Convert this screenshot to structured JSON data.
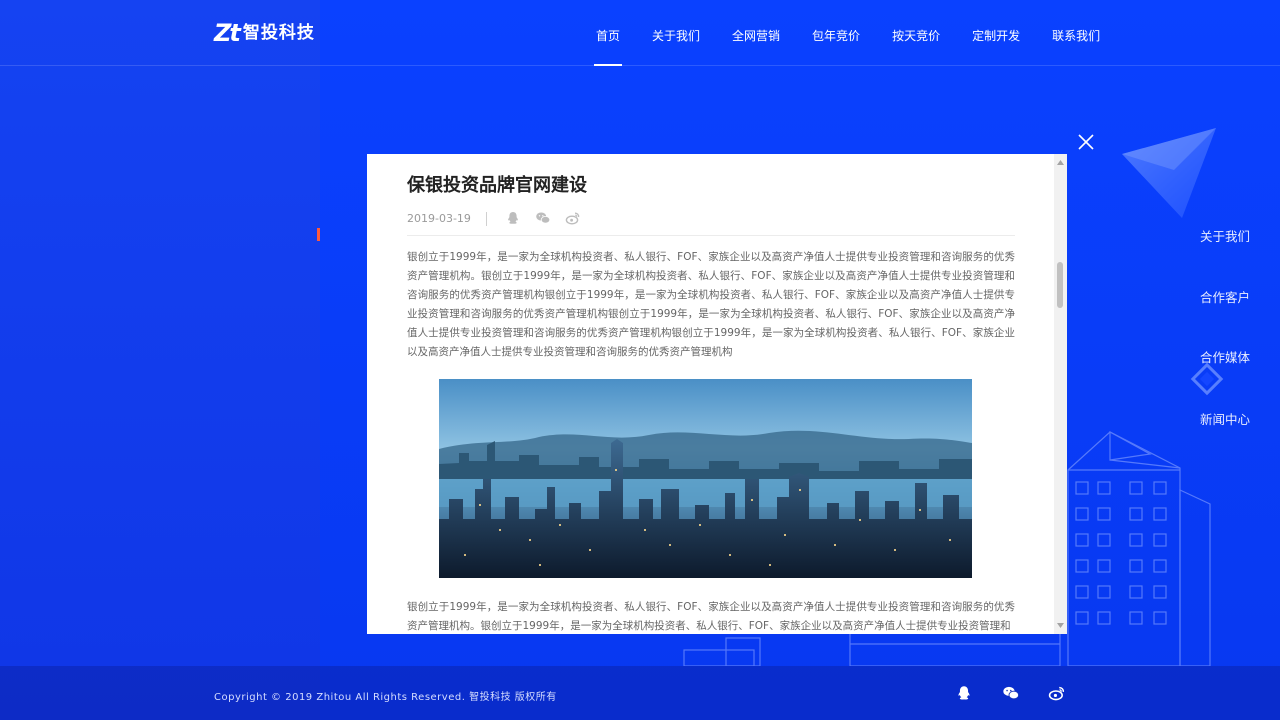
{
  "brand": {
    "mark": "Zt",
    "name": "智投科技"
  },
  "nav": [
    {
      "label": "首页",
      "active": true
    },
    {
      "label": "关于我们"
    },
    {
      "label": "全网营销"
    },
    {
      "label": "包年竞价"
    },
    {
      "label": "按天竞价"
    },
    {
      "label": "定制开发"
    },
    {
      "label": "联系我们"
    }
  ],
  "sidebar": {
    "items": [
      {
        "label": "关于我们",
        "active": true
      },
      {
        "label": "合作客户"
      },
      {
        "label": "合作媒体"
      },
      {
        "label": "新闻中心"
      }
    ],
    "accent_color": "#ff5a3c"
  },
  "article": {
    "title": "保银投资品牌官网建设",
    "date": "2019-03-19",
    "share_icons": [
      "qq-icon",
      "wechat-icon",
      "weibo-icon"
    ],
    "paragraph1": "银创立于1999年，是一家为全球机构投资者、私人银行、FOF、家族企业以及高资产净值人士提供专业投资管理和咨询服务的优秀资产管理机构。银创立于1999年，是一家为全球机构投资者、私人银行、FOF、家族企业以及高资产净值人士提供专业投资管理和咨询服务的优秀资产管理机构银创立于1999年，是一家为全球机构投资者、私人银行、FOF、家族企业以及高资产净值人士提供专业投资管理和咨询服务的优秀资产管理机构银创立于1999年，是一家为全球机构投资者、私人银行、FOF、家族企业以及高资产净值人士提供专业投资管理和咨询服务的优秀资产管理机构银创立于1999年，是一家为全球机构投资者、私人银行、FOF、家族企业以及高资产净值人士提供专业投资管理和咨询服务的优秀资产管理机构",
    "paragraph2": "银创立于1999年，是一家为全球机构投资者、私人银行、FOF、家族企业以及高资产净值人士提供专业投资管理和咨询服务的优秀资产管理机构。银创立于1999年，是一家为全球机构投资者、私人银行、FOF、家族企业以及高资产净值人士提供专业投资管理和"
  },
  "footer": {
    "copyright": "Copyright © 2019 Zhitou All Rights Reserved. 智投科技 版权所有",
    "icons": [
      "qq-icon",
      "wechat-icon",
      "weibo-icon"
    ]
  },
  "colors": {
    "background": "#0a3cf0",
    "panel_left": "#1543f2",
    "modal": "#ffffff"
  }
}
